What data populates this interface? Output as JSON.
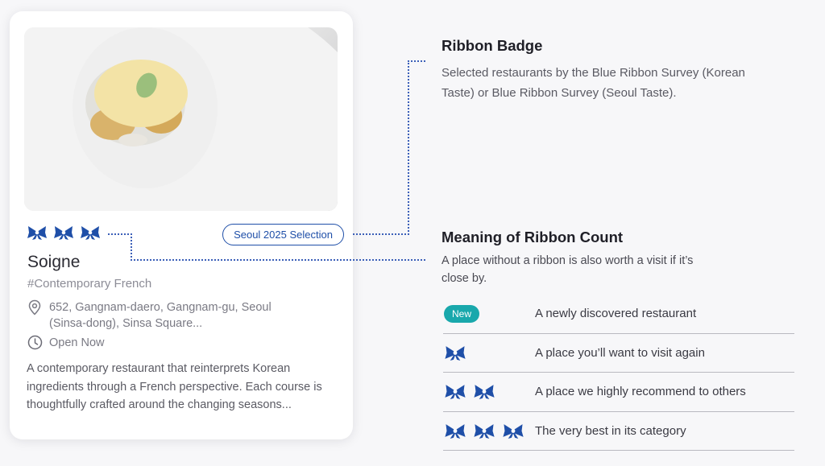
{
  "card": {
    "badge": "Seoul 2025 Selection",
    "ribbon_count": 3,
    "name": "Soigne",
    "tag": "#Contemporary French",
    "address": "652, Gangnam-daero, Gangnam-gu, Seoul (Sinsa-dong), Sinsa Square...",
    "hours_status": "Open Now",
    "description": "A contemporary restaurant that reinterprets Korean ingredients through a French perspective. Each course is thoughtfully crafted around the changing seasons..."
  },
  "ribbon_badge_section": {
    "title": "Ribbon Badge",
    "text": "Selected restaurants by the Blue Ribbon Survey (Korean Taste) or Blue Ribbon Survey (Seoul Taste)."
  },
  "ribbon_count_section": {
    "title": "Meaning of Ribbon Count",
    "text": "A place without a ribbon is also worth a visit if it’s close by.",
    "rows": [
      {
        "new_label": "New",
        "ribbons": 0,
        "meaning": "A newly discovered restaurant"
      },
      {
        "ribbons": 1,
        "meaning": "A place you’ll want to visit again"
      },
      {
        "ribbons": 2,
        "meaning": "A place we highly recommend to others"
      },
      {
        "ribbons": 3,
        "meaning": "The very best in its category"
      }
    ]
  },
  "colors": {
    "ribbon_blue": "#1f4fa8",
    "new_badge_teal": "#19a8ac",
    "connector": "#3b5fb8"
  },
  "icons": {
    "ribbon": "ribbon-icon",
    "location": "location-pin-icon",
    "clock": "clock-icon"
  }
}
